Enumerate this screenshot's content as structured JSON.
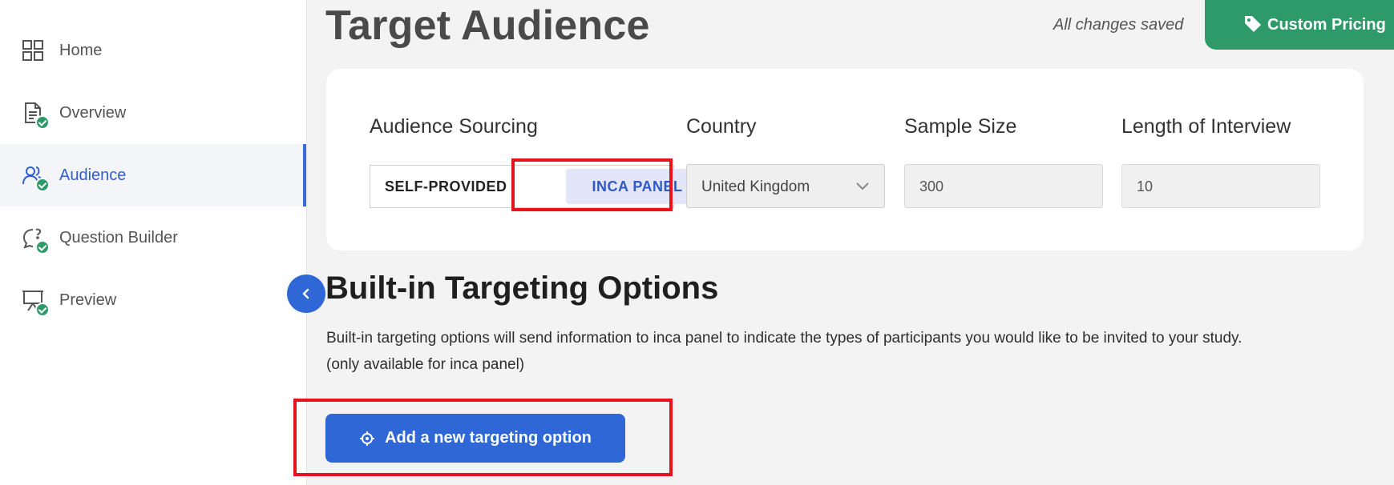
{
  "sidebar": {
    "items": [
      {
        "label": "Home",
        "icon": "grid-icon",
        "completed": false
      },
      {
        "label": "Overview",
        "icon": "document-icon",
        "completed": true
      },
      {
        "label": "Audience",
        "icon": "users-icon",
        "completed": true,
        "active": true
      },
      {
        "label": "Question Builder",
        "icon": "question-bubble-icon",
        "completed": true
      },
      {
        "label": "Preview",
        "icon": "presentation-icon",
        "completed": true
      }
    ]
  },
  "header": {
    "title": "Target Audience",
    "saved_status": "All changes saved",
    "pricing_button": "Custom Pricing"
  },
  "audience": {
    "sourcing_label": "Audience Sourcing",
    "sourcing_options": [
      "SELF-PROVIDED",
      "INCA PANEL"
    ],
    "selected_sourcing": "INCA PANEL",
    "country_label": "Country",
    "country_value": "United Kingdom",
    "sample_label": "Sample Size",
    "sample_value": "300",
    "loi_label": "Length of Interview",
    "loi_value": "10"
  },
  "targeting": {
    "title": "Built-in Targeting Options",
    "description_line1": "Built-in targeting options will send information to inca panel to indicate the types of participants you would like to be invited to your study.",
    "description_line2": "(only available for inca panel)",
    "add_button": "Add a new targeting option"
  },
  "colors": {
    "accent": "#2f67d6",
    "success": "#2e9a6a",
    "highlight": "#e8121a",
    "active_segment_bg": "#e3e5f9"
  }
}
